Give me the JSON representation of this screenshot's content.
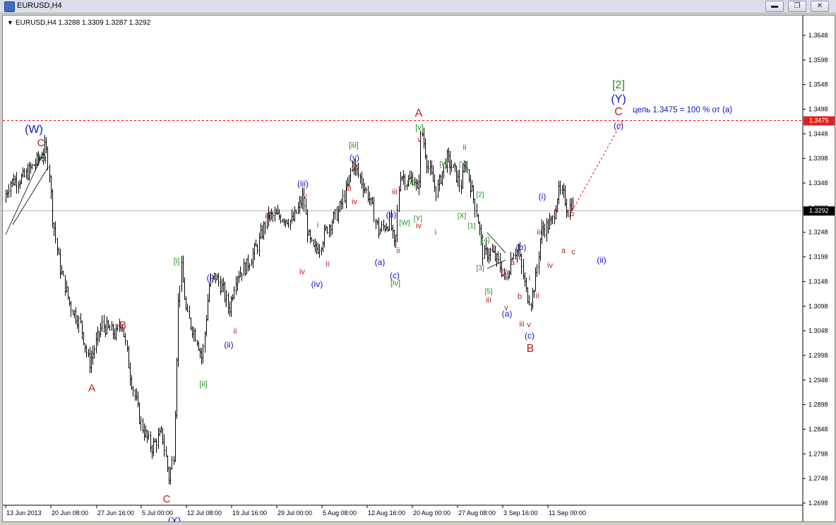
{
  "window": {
    "title": "EURUSD,H4",
    "icon": "app-icon",
    "buttons": [
      {
        "name": "minimize-button",
        "glyph": "▬"
      },
      {
        "name": "restore-button",
        "glyph": "❐"
      },
      {
        "name": "close-button",
        "glyph": "✕"
      }
    ]
  },
  "chart": {
    "info_text": "EURUSD,H4  1.3288 1.3309 1.3287 1.3292",
    "info_arrow": "▼",
    "current_price": "1.3292",
    "target_price_label": "1.3475",
    "target_note": "цель 1.3475 = 100 % от (a)",
    "colors": {
      "red": "#b22222",
      "green": "#1e8c1e",
      "blue": "#1010c8",
      "level": "#ff0000",
      "price_box": "#e02020"
    }
  },
  "chart_data": {
    "type": "ohlc",
    "symbol": "EURUSD",
    "timeframe": "H4",
    "last": {
      "open": 1.3288,
      "high": 1.3309,
      "low": 1.3287,
      "close": 1.3292
    },
    "y_ticks": [
      "1.3648",
      "1.3598",
      "1.3548",
      "1.3498",
      "1.3448",
      "1.3398",
      "1.3348",
      "1.3298",
      "1.3248",
      "1.3198",
      "1.3148",
      "1.3098",
      "1.3048",
      "1.2998",
      "1.2948",
      "1.2898",
      "1.2848",
      "1.2798",
      "1.2748",
      "1.2698"
    ],
    "ylim": [
      1.268,
      1.367
    ],
    "x_ticks": [
      "13 Jun 2013",
      "20 Jun 08:00",
      "27 Jun 16:00",
      "5 Jul 00:00",
      "12 Jul 08:00",
      "19 Jul 16:00",
      "29 Jul 00:00",
      "5 Aug 08:00",
      "12 Aug 16:00",
      "20 Aug 00:00",
      "27 Aug 08:00",
      "3 Sep 16:00",
      "11 Sep 00:00"
    ],
    "horizontal_level": 1.3475,
    "current_line": 1.3292,
    "waypoints": [
      [
        0,
        1.331
      ],
      [
        10,
        1.335
      ],
      [
        30,
        1.336
      ],
      [
        52,
        1.34
      ],
      [
        60,
        1.342
      ],
      [
        65,
        1.338
      ],
      [
        70,
        1.328
      ],
      [
        80,
        1.318
      ],
      [
        95,
        1.31
      ],
      [
        110,
        1.306
      ],
      [
        122,
        1.298
      ],
      [
        140,
        1.306
      ],
      [
        160,
        1.304
      ],
      [
        168,
        1.307
      ],
      [
        180,
        1.296
      ],
      [
        195,
        1.286
      ],
      [
        210,
        1.281
      ],
      [
        225,
        1.284
      ],
      [
        235,
        1.275
      ],
      [
        242,
        1.28
      ],
      [
        248,
        1.31
      ],
      [
        252,
        1.318
      ],
      [
        260,
        1.308
      ],
      [
        275,
        1.303
      ],
      [
        282,
        1.299
      ],
      [
        292,
        1.314
      ],
      [
        300,
        1.316
      ],
      [
        312,
        1.313
      ],
      [
        320,
        1.309
      ],
      [
        330,
        1.316
      ],
      [
        345,
        1.318
      ],
      [
        360,
        1.322
      ],
      [
        375,
        1.328
      ],
      [
        395,
        1.328
      ],
      [
        410,
        1.327
      ],
      [
        425,
        1.332
      ],
      [
        432,
        1.324
      ],
      [
        440,
        1.321
      ],
      [
        448,
        1.322
      ],
      [
        460,
        1.326
      ],
      [
        475,
        1.329
      ],
      [
        488,
        1.334
      ],
      [
        495,
        1.339
      ],
      [
        505,
        1.336
      ],
      [
        518,
        1.332
      ],
      [
        532,
        1.325
      ],
      [
        548,
        1.327
      ],
      [
        555,
        1.321
      ],
      [
        562,
        1.337
      ],
      [
        572,
        1.335
      ],
      [
        582,
        1.336
      ],
      [
        588,
        1.332
      ],
      [
        592,
        1.346
      ],
      [
        602,
        1.338
      ],
      [
        614,
        1.333
      ],
      [
        628,
        1.34
      ],
      [
        640,
        1.337
      ],
      [
        648,
        1.334
      ],
      [
        655,
        1.339
      ],
      [
        664,
        1.333
      ],
      [
        672,
        1.328
      ],
      [
        680,
        1.32
      ],
      [
        690,
        1.321
      ],
      [
        700,
        1.319
      ],
      [
        712,
        1.315
      ],
      [
        722,
        1.321
      ],
      [
        730,
        1.321
      ],
      [
        735,
        1.317
      ],
      [
        742,
        1.312
      ],
      [
        748,
        1.311
      ],
      [
        755,
        1.316
      ],
      [
        762,
        1.325
      ],
      [
        770,
        1.326
      ],
      [
        778,
        1.327
      ],
      [
        786,
        1.333
      ],
      [
        795,
        1.332
      ],
      [
        800,
        1.329
      ],
      [
        805,
        1.331
      ],
      [
        810,
        1.329
      ]
    ],
    "projection": {
      "to_level": 1.3475
    },
    "annotations": [
      {
        "t": "(W)",
        "x": 44,
        "y": 162,
        "c": "blue",
        "s": 16
      },
      {
        "t": "C",
        "x": 54,
        "y": 181,
        "c": "red",
        "s": 15
      },
      {
        "t": "[v]",
        "x": 56,
        "y": 204,
        "c": "green",
        "s": 11
      },
      {
        "t": "A",
        "x": 126,
        "y": 528,
        "c": "red",
        "s": 15
      },
      {
        "t": "B",
        "x": 170,
        "y": 439,
        "c": "red",
        "s": 15
      },
      {
        "t": "C",
        "x": 232,
        "y": 685,
        "c": "red",
        "s": 15
      },
      {
        "t": "(X)",
        "x": 243,
        "y": 716,
        "c": "blue",
        "s": 14
      },
      {
        "t": "[i]",
        "x": 246,
        "y": 348,
        "c": "green",
        "s": 11
      },
      {
        "t": "[ii]",
        "x": 284,
        "y": 522,
        "c": "green",
        "s": 11
      },
      {
        "t": "(i)",
        "x": 294,
        "y": 372,
        "c": "blue",
        "s": 12
      },
      {
        "t": "i",
        "x": 316,
        "y": 410,
        "c": "red",
        "s": 11
      },
      {
        "t": "ii",
        "x": 329,
        "y": 447,
        "c": "red",
        "s": 11
      },
      {
        "t": "(ii)",
        "x": 320,
        "y": 467,
        "c": "blue",
        "s": 12
      },
      {
        "t": "iii",
        "x": 375,
        "y": 284,
        "c": "red",
        "s": 11
      },
      {
        "t": "(iii)",
        "x": 425,
        "y": 239,
        "c": "blue",
        "s": 12
      },
      {
        "t": "v",
        "x": 428,
        "y": 256,
        "c": "red",
        "s": 11
      },
      {
        "t": "iv",
        "x": 424,
        "y": 363,
        "c": "red",
        "s": 11
      },
      {
        "t": "(iv)",
        "x": 445,
        "y": 381,
        "c": "blue",
        "s": 12
      },
      {
        "t": "i",
        "x": 446,
        "y": 297,
        "c": "red",
        "s": 11
      },
      {
        "t": "ii",
        "x": 460,
        "y": 352,
        "c": "red",
        "s": 11
      },
      {
        "t": "[iii]",
        "x": 497,
        "y": 184,
        "c": "green",
        "s": 11
      },
      {
        "t": "(v)",
        "x": 498,
        "y": 202,
        "c": "blue",
        "s": 12
      },
      {
        "t": "v",
        "x": 497,
        "y": 217,
        "c": "red",
        "s": 11
      },
      {
        "t": "iii",
        "x": 490,
        "y": 245,
        "c": "red",
        "s": 11
      },
      {
        "t": "iv",
        "x": 498,
        "y": 264,
        "c": "red",
        "s": 11
      },
      {
        "t": "(a)",
        "x": 534,
        "y": 350,
        "c": "blue",
        "s": 12
      },
      {
        "t": "(b)",
        "x": 550,
        "y": 283,
        "c": "blue",
        "s": 12
      },
      {
        "t": "iii",
        "x": 555,
        "y": 250,
        "c": "red",
        "s": 11
      },
      {
        "t": "ii",
        "x": 560,
        "y": 333,
        "c": "red",
        "s": 11
      },
      {
        "t": "(c)",
        "x": 555,
        "y": 369,
        "c": "blue",
        "s": 12
      },
      {
        "t": "[iv]",
        "x": 556,
        "y": 379,
        "c": "green",
        "s": 11
      },
      {
        "t": "[W]",
        "x": 569,
        "y": 294,
        "c": "green",
        "s": 10
      },
      {
        "t": "[X]",
        "x": 578,
        "y": 238,
        "c": "green",
        "s": 10
      },
      {
        "t": "[Y]",
        "x": 588,
        "y": 288,
        "c": "green",
        "s": 10
      },
      {
        "t": "iv",
        "x": 589,
        "y": 298,
        "c": "red",
        "s": 11
      },
      {
        "t": "A",
        "x": 589,
        "y": 139,
        "c": "red",
        "s": 16
      },
      {
        "t": "[v]",
        "x": 590,
        "y": 159,
        "c": "green",
        "s": 11
      },
      {
        "t": "v",
        "x": 590,
        "y": 176,
        "c": "red",
        "s": 11
      },
      {
        "t": "i",
        "x": 613,
        "y": 307,
        "c": "red",
        "s": 11
      },
      {
        "t": "ii",
        "x": 654,
        "y": 187,
        "c": "red",
        "s": 11
      },
      {
        "t": "[W]",
        "x": 626,
        "y": 211,
        "c": "green",
        "s": 10
      },
      {
        "t": "[Y]",
        "x": 652,
        "y": 211,
        "c": "green",
        "s": 10
      },
      {
        "t": "[X]",
        "x": 650,
        "y": 284,
        "c": "green",
        "s": 10
      },
      {
        "t": "[2]",
        "x": 676,
        "y": 254,
        "c": "green",
        "s": 10
      },
      {
        "t": "[1]",
        "x": 664,
        "y": 298,
        "c": "green",
        "s": 10
      },
      {
        "t": "[4]",
        "x": 684,
        "y": 318,
        "c": "green",
        "s": 10
      },
      {
        "t": "[3]",
        "x": 676,
        "y": 358,
        "c": "green",
        "s": 10
      },
      {
        "t": "[5]",
        "x": 688,
        "y": 391,
        "c": "green",
        "s": 10
      },
      {
        "t": "iii",
        "x": 688,
        "y": 403,
        "c": "red",
        "s": 11
      },
      {
        "t": "iv",
        "x": 710,
        "y": 362,
        "c": "red",
        "s": 11
      },
      {
        "t": "v",
        "x": 713,
        "y": 414,
        "c": "red",
        "s": 11
      },
      {
        "t": "(a)",
        "x": 714,
        "y": 423,
        "c": "blue",
        "s": 12
      },
      {
        "t": "(b)",
        "x": 734,
        "y": 329,
        "c": "blue",
        "s": 12
      },
      {
        "t": "a",
        "x": 722,
        "y": 350,
        "c": "red",
        "s": 11
      },
      {
        "t": "c",
        "x": 733,
        "y": 343,
        "c": "red",
        "s": 11
      },
      {
        "t": "b",
        "x": 732,
        "y": 398,
        "c": "red",
        "s": 11
      },
      {
        "t": "i",
        "x": 746,
        "y": 372,
        "c": "red",
        "s": 11
      },
      {
        "t": "ii",
        "x": 757,
        "y": 397,
        "c": "red",
        "s": 11
      },
      {
        "t": "iii",
        "x": 735,
        "y": 437,
        "c": "red",
        "s": 11
      },
      {
        "t": "v",
        "x": 745,
        "y": 438,
        "c": "red",
        "s": 11
      },
      {
        "t": "(c)",
        "x": 746,
        "y": 454,
        "c": "blue",
        "s": 12
      },
      {
        "t": "B",
        "x": 747,
        "y": 472,
        "c": "red",
        "s": 16
      },
      {
        "t": "(i)",
        "x": 764,
        "y": 257,
        "c": "blue",
        "s": 12
      },
      {
        "t": "iii",
        "x": 760,
        "y": 307,
        "c": "red",
        "s": 11
      },
      {
        "t": "iv",
        "x": 775,
        "y": 354,
        "c": "red",
        "s": 11
      },
      {
        "t": "v",
        "x": 784,
        "y": 276,
        "c": "red",
        "s": 11
      },
      {
        "t": "b",
        "x": 806,
        "y": 281,
        "c": "red",
        "s": 11
      },
      {
        "t": "a",
        "x": 794,
        "y": 333,
        "c": "red",
        "s": 11
      },
      {
        "t": "c",
        "x": 808,
        "y": 335,
        "c": "red",
        "s": 11
      },
      {
        "t": "(ii)",
        "x": 848,
        "y": 347,
        "c": "blue",
        "s": 12
      },
      {
        "t": "[2]",
        "x": 872,
        "y": 99,
        "c": "green",
        "s": 16
      },
      {
        "t": "(Y)",
        "x": 872,
        "y": 119,
        "c": "blue",
        "s": 16
      },
      {
        "t": "C",
        "x": 872,
        "y": 137,
        "c": "red",
        "s": 16
      },
      {
        "t": "(c)",
        "x": 872,
        "y": 157,
        "c": "blue",
        "s": 12
      }
    ]
  }
}
